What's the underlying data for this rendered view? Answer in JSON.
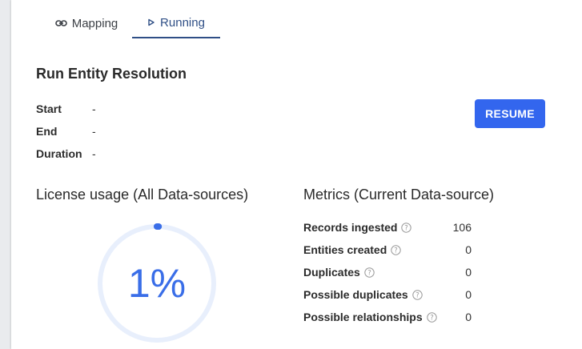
{
  "tabs": [
    {
      "label": "Mapping",
      "icon": "link-icon",
      "active": false
    },
    {
      "label": "Running",
      "icon": "play-icon",
      "active": true
    }
  ],
  "run": {
    "title": "Run Entity Resolution",
    "rows": [
      {
        "label": "Start",
        "value": "-"
      },
      {
        "label": "End",
        "value": "-"
      },
      {
        "label": "Duration",
        "value": "-"
      }
    ],
    "resume_label": "RESUME"
  },
  "license": {
    "title": "License usage (All Data-sources)",
    "percent_label": "1%",
    "percent": 1
  },
  "metrics": {
    "title": "Metrics (Current Data-source)",
    "rows": [
      {
        "label": "Records ingested",
        "value": "106"
      },
      {
        "label": "Entities created",
        "value": "0"
      },
      {
        "label": "Duplicates",
        "value": "0"
      },
      {
        "label": "Possible duplicates",
        "value": "0"
      },
      {
        "label": "Possible relationships",
        "value": "0"
      }
    ]
  },
  "colors": {
    "accent": "#3366ee",
    "tab_active": "#2f4f86",
    "gauge_track": "#e8effc",
    "gauge_fill": "#3a6ee8"
  }
}
